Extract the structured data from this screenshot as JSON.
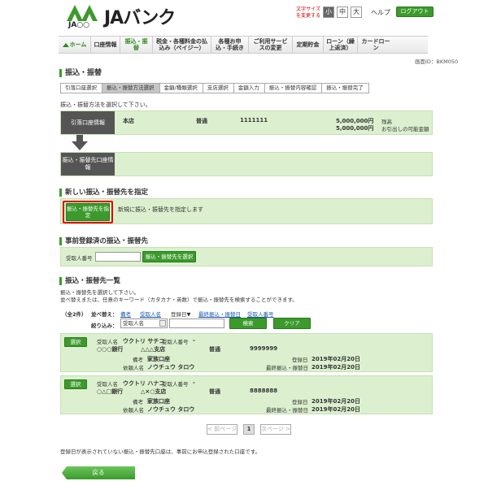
{
  "header": {
    "logo_text": "JAバンク",
    "logo_sub": "JA○○",
    "font_size_label": "文字サイズを変更する",
    "font_sizes": [
      "小",
      "中",
      "大"
    ],
    "help": "ヘルプ",
    "logout": "ログアウト"
  },
  "nav": [
    {
      "label": "ホーム",
      "icon": "home-icon"
    },
    {
      "label": "口座情報"
    },
    {
      "label": "振込・振替"
    },
    {
      "label": "税金・各種料金の払込み（ペイジー）"
    },
    {
      "label": "各種お申込・手続き"
    },
    {
      "label": "ご利用サービスの変更"
    },
    {
      "label": "定期貯金"
    },
    {
      "label": "ローン（繰上返済）"
    },
    {
      "label": "カードローン"
    }
  ],
  "screen_id": "画面ID：BKM050",
  "page_title": "振込・振替",
  "steps": [
    "引落口座選択",
    "振込・振替方法選択",
    "金額/種類選択",
    "支店選択",
    "金額入力",
    "振込・振替内容確認",
    "振込・振替完了"
  ],
  "instruction": "振込・振替方法を選択して下さい。",
  "account": {
    "label": "引落口座情報",
    "branch": "本店",
    "type": "普通",
    "number": "1111111",
    "balance": "5,000,000円",
    "balance_label": "残高",
    "available": "5,000,000円",
    "available_label": "お引出しの可能金額"
  },
  "dest_label": "振込・振替先口座情報",
  "new_section": {
    "title": "新しい振込・振替先を指定",
    "button": "振込・振替先を指定",
    "description": "新規に振込・振替先を指定します"
  },
  "registered": {
    "title": "事前登録済の振込・振替先",
    "field_label": "受取人番号",
    "field_value": "",
    "button": "振込・振替先を選択"
  },
  "list": {
    "title": "振込・振替先一覧",
    "desc1": "振込・振替先を選択して下さい。",
    "desc2": "並べ替えまたは、任意のキーワード（カタカナ・英数）で振込・振替先を検索することができます。",
    "count": "（全2件）",
    "sort_label": "並べ替え：",
    "sort_options": [
      "備考",
      "受取人名",
      "登録日▼",
      "最終振込・振替日",
      "受取人番号"
    ],
    "filter_label": "絞り込み：",
    "filter_select": "受取人名",
    "filter_value": "",
    "search_btn": "検索",
    "clear_btn": "クリア"
  },
  "entries": [
    {
      "select": "選択",
      "name_label": "受取人名",
      "name": "ウクトリ サチコ",
      "num_label": "受取人番号",
      "num": "-",
      "bank": "○○○銀行",
      "branch": "△△△支店",
      "type": "普通",
      "account": "9999999",
      "note_label": "備考",
      "note": "家族口座",
      "reg_label": "登録日",
      "reg": "2019年02月20日",
      "client_label": "依頼人名",
      "client": "ノウチュウ タロウ",
      "last_label": "最終振込・振替日",
      "last": "2019年02月20日"
    },
    {
      "select": "選択",
      "name_label": "受取人名",
      "name": "ウクトリ ハナコ",
      "num_label": "受取人番号",
      "num": "-",
      "bank": "○△□銀行",
      "branch": "△×○支店",
      "type": "普通",
      "account": "8888888",
      "note_label": "備考",
      "note": "家族口座",
      "reg_label": "登録日",
      "reg": "2019年02月20日",
      "client_label": "依頼人名",
      "client": "ノウチュウ タロウ",
      "last_label": "最終振込・振替日",
      "last": "2019年02月20日"
    }
  ],
  "pagination": {
    "prev": "前ページ",
    "current": "1",
    "next": "次ページ"
  },
  "footer_note": "登録日が表示されていない振込・振替先口座は、事前にお申込登録された口座です。",
  "back": "戻る",
  "colors": {
    "accent": "#3c9a2c",
    "highlight": "#e00000",
    "panel": "#dcf0cf"
  }
}
